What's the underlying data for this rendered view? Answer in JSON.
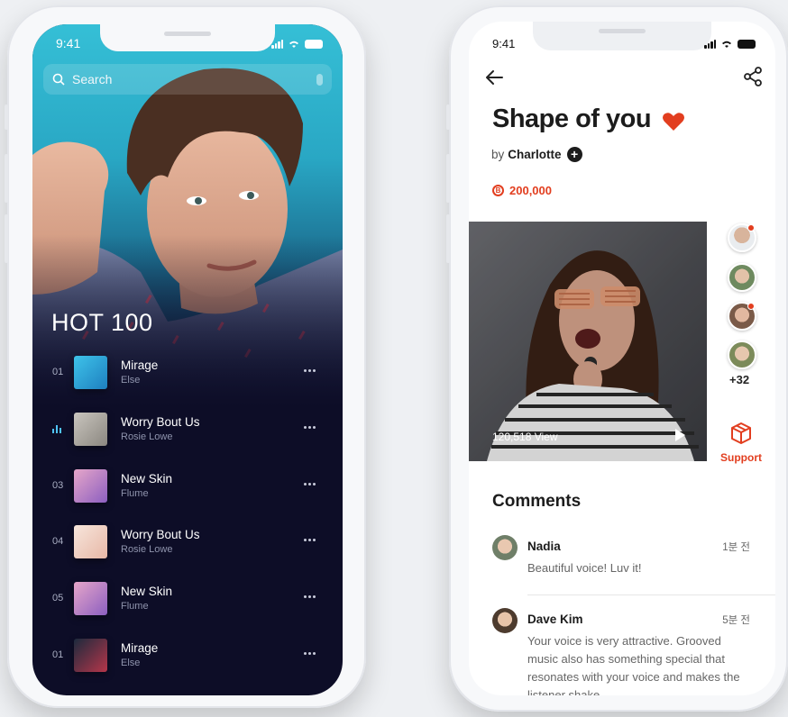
{
  "left_phone": {
    "status_time": "9:41",
    "search": {
      "placeholder": "Search"
    },
    "heading": "HOT 100",
    "tracks": [
      {
        "rank": "01",
        "title": "Mirage",
        "artist": "Else"
      },
      {
        "rank": "",
        "title": "Worry Bout Us",
        "artist": "Rosie Lowe",
        "now_playing": true
      },
      {
        "rank": "03",
        "title": "New Skin",
        "artist": "Flume"
      },
      {
        "rank": "04",
        "title": "Worry Bout Us",
        "artist": "Rosie Lowe"
      },
      {
        "rank": "05",
        "title": "New Skin",
        "artist": "Flume"
      },
      {
        "rank": "01",
        "title": "Mirage",
        "artist": "Else"
      }
    ]
  },
  "right_phone": {
    "status_time": "9:41",
    "song": {
      "title": "Shape of you",
      "by_prefix": "by",
      "artist": "Charlotte",
      "price": "200,000"
    },
    "video": {
      "views": "120,518 View"
    },
    "listeners_more": "+32",
    "support_label": "Support",
    "comments_heading": "Comments",
    "comments": [
      {
        "name": "Nadia",
        "time": "1분 전",
        "text": "Beautiful voice! Luv it!"
      },
      {
        "name": "Dave Kim",
        "time": "5분 전",
        "text": "Your voice is very attractive. Grooved music also has something special that resonates with your voice and makes the listener shake"
      }
    ]
  },
  "colors": {
    "accent_red": "#e23e1f",
    "dark_bg": "#0d0d27",
    "hero_cyan": "#35bfd6"
  }
}
